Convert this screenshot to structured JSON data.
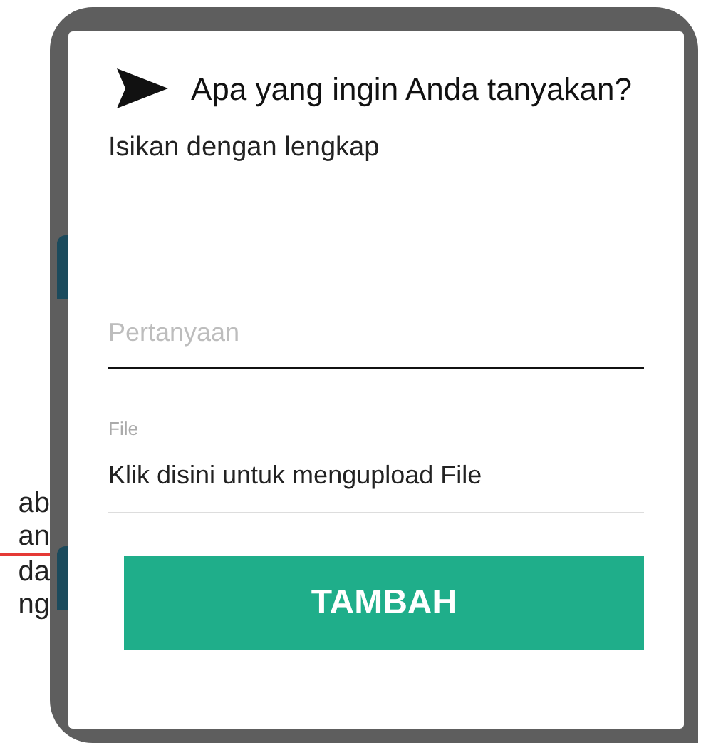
{
  "background_text_lines": [
    "ab",
    "an",
    "da",
    "ng"
  ],
  "dialog": {
    "title": "Apa yang ingin Anda tanyakan?",
    "subtitle": "Isikan dengan lengkap",
    "question_field": {
      "placeholder": "Pertanyaan"
    },
    "file_field": {
      "label": "File",
      "value": "Klik disini untuk mengupload File"
    },
    "button": "TAMBAH"
  }
}
